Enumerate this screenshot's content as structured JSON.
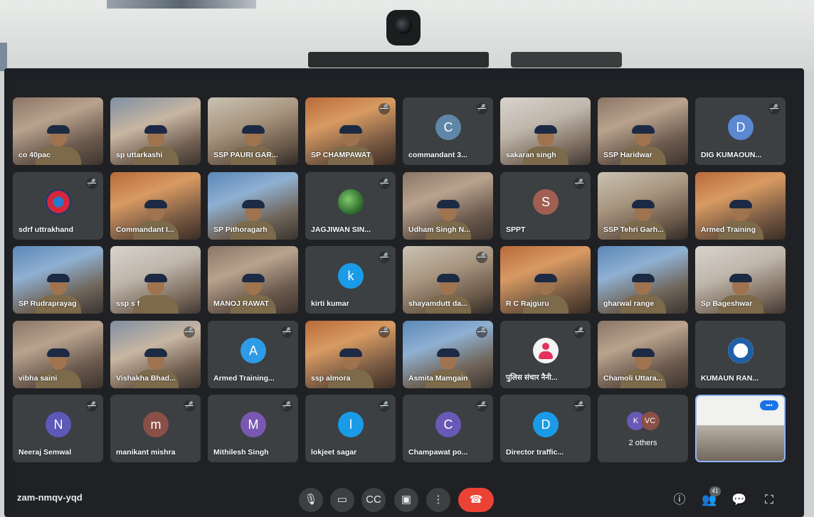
{
  "meeting": {
    "code": "zam-nmqv-yqd",
    "participant_count": "41"
  },
  "tiles": [
    {
      "name": "co 40pac",
      "type": "video",
      "muted": false
    },
    {
      "name": "sp uttarkashi",
      "type": "video",
      "muted": false
    },
    {
      "name": "SSP PAURI GAR...",
      "type": "video",
      "muted": false
    },
    {
      "name": "SP CHAMPAWAT",
      "type": "video",
      "muted": true
    },
    {
      "name": "commandant 3...",
      "type": "avatar",
      "initial": "C",
      "avatar_color": "#5f86a6",
      "muted": true
    },
    {
      "name": "sakaran singh",
      "type": "video",
      "muted": false
    },
    {
      "name": "SSP Haridwar",
      "type": "video",
      "muted": false
    },
    {
      "name": "DIG KUMAOUN...",
      "type": "avatar",
      "initial": "D",
      "avatar_color": "#5b88d0",
      "muted": true
    },
    {
      "name": "sdrf uttrakhand",
      "type": "avatar-logo",
      "muted": true
    },
    {
      "name": "Commandant I...",
      "type": "video",
      "muted": false
    },
    {
      "name": "SP Pithoragarh",
      "type": "video",
      "muted": false
    },
    {
      "name": "JAGJIWAN SIN...",
      "type": "avatar-earth",
      "muted": true
    },
    {
      "name": "Udham Singh N...",
      "type": "video",
      "muted": false
    },
    {
      "name": "SPPT",
      "type": "avatar",
      "initial": "S",
      "avatar_color": "#a05f52",
      "muted": true
    },
    {
      "name": "SSP Tehri Garh...",
      "type": "video",
      "muted": false
    },
    {
      "name": "Armed Training",
      "type": "video",
      "muted": false
    },
    {
      "name": "SP Rudraprayag",
      "type": "video",
      "muted": false
    },
    {
      "name": "ssp s f",
      "type": "video",
      "muted": false
    },
    {
      "name": "MANOJ RAWAT",
      "type": "video",
      "muted": false
    },
    {
      "name": "kirti kumar",
      "type": "avatar",
      "initial": "k",
      "avatar_color": "#1a9be8",
      "muted": true
    },
    {
      "name": "shayamdutt da...",
      "type": "video",
      "muted": true
    },
    {
      "name": "R C Rajguru",
      "type": "video",
      "muted": false
    },
    {
      "name": "gharwal range",
      "type": "video",
      "muted": false
    },
    {
      "name": "Sp Bageshwar",
      "type": "video",
      "muted": false
    },
    {
      "name": "vibha saini",
      "type": "video",
      "muted": false
    },
    {
      "name": "Vishakha Bhad...",
      "type": "video",
      "muted": true
    },
    {
      "name": "Armed Training...",
      "type": "avatar",
      "initial": "A",
      "avatar_color": "#2d9be6",
      "muted": true
    },
    {
      "name": "ssp almora",
      "type": "video",
      "muted": true
    },
    {
      "name": "Asmita Mamgain",
      "type": "video",
      "muted": true
    },
    {
      "name": "पुलिस संचार नैनी...",
      "type": "avatar-profile",
      "muted": true
    },
    {
      "name": "Chamoli Uttara...",
      "type": "video",
      "muted": false
    },
    {
      "name": "KUMAUN RAN...",
      "type": "avatar-emblem",
      "muted": false
    },
    {
      "name": "Neeraj Semwal",
      "type": "avatar",
      "initial": "N",
      "avatar_color": "#5e58b8",
      "muted": true
    },
    {
      "name": "manikant mishra",
      "type": "avatar",
      "initial": "m",
      "avatar_color": "#8a4f47",
      "muted": true
    },
    {
      "name": "Mithilesh Singh",
      "type": "avatar",
      "initial": "M",
      "avatar_color": "#7a58b2",
      "muted": true
    },
    {
      "name": "lokjeet sagar",
      "type": "avatar",
      "initial": "l",
      "avatar_color": "#1a9be8",
      "muted": true
    },
    {
      "name": "Champawat po...",
      "type": "avatar",
      "initial": "C",
      "avatar_color": "#6a58b6",
      "muted": true
    },
    {
      "name": "Director traffic...",
      "type": "avatar",
      "initial": "D",
      "avatar_color": "#1a9be8",
      "muted": true
    },
    {
      "name": "2 others",
      "type": "others",
      "initials": [
        "K",
        "VC"
      ],
      "muted": false
    },
    {
      "name": "",
      "type": "self",
      "muted": false
    }
  ],
  "controls": {
    "mic": "microphone-icon",
    "camera": "camera-icon",
    "captions": "captions-icon",
    "present": "present-icon",
    "more": "more-options-icon",
    "end_call": "end-call-icon"
  },
  "right_controls": [
    "info-icon",
    "people-icon",
    "chat-icon",
    "activities-icon"
  ],
  "colors": {
    "tile_bg": "#3c4043",
    "screen_bg": "#202124",
    "end_call": "#ea4335",
    "accent": "#8ab4f8"
  }
}
